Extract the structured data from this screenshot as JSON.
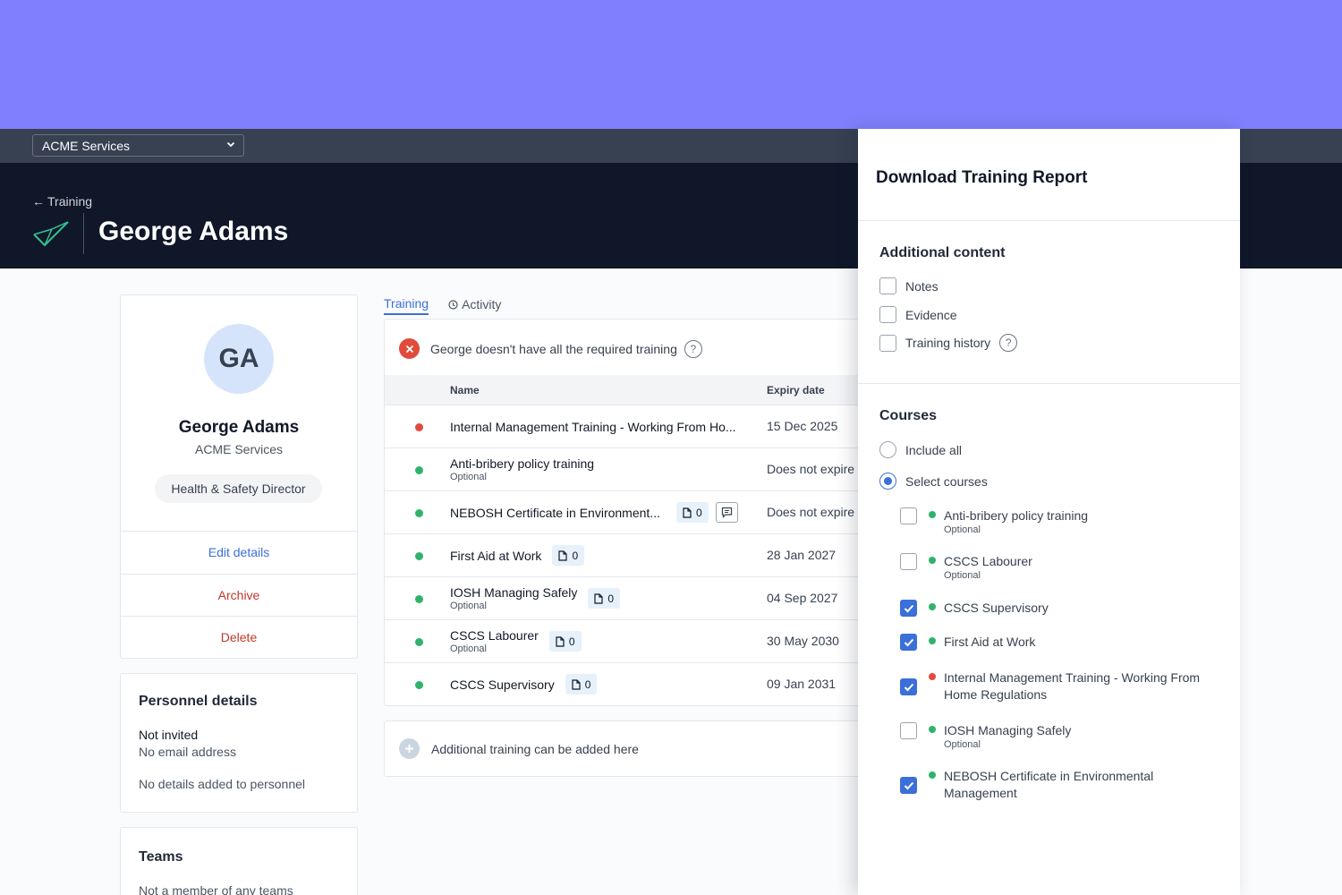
{
  "topbar": {
    "org_select": "ACME Services"
  },
  "header": {
    "back_label": "Training",
    "title": "George Adams"
  },
  "profile": {
    "initials": "GA",
    "name": "George Adams",
    "org": "ACME Services",
    "role": "Health & Safety Director",
    "actions": {
      "edit": "Edit details",
      "archive": "Archive",
      "delete": "Delete"
    }
  },
  "personnel": {
    "title": "Personnel details",
    "status": "Not invited",
    "email": "No email address",
    "details": "No details added to personnel"
  },
  "teams": {
    "title": "Teams",
    "subtitle": "Not a member of any teams"
  },
  "tabs": {
    "training": "Training",
    "activity": "Activity"
  },
  "training": {
    "alert": "George doesn't have all the required training",
    "help": "?",
    "col_name": "Name",
    "col_expiry": "Expiry date",
    "rows": [
      {
        "name": "Internal Management Training - Working From Ho...",
        "optional": "",
        "evidence": "",
        "expiry": "15 Dec 2025",
        "status_color": "#e14b3b"
      },
      {
        "name": "Anti-bribery policy training",
        "optional": "Optional",
        "evidence": "",
        "expiry": "Does not expire",
        "status_color": "#2fb36b"
      },
      {
        "name": "NEBOSH Certificate in Environment...",
        "optional": "",
        "evidence": "0",
        "expiry": "Does not expire",
        "status_color": "#2fb36b"
      },
      {
        "name": "First Aid at Work",
        "optional": "",
        "evidence": "0",
        "expiry": "28 Jan 2027",
        "status_color": "#2fb36b"
      },
      {
        "name": "IOSH Managing Safely",
        "optional": "Optional",
        "evidence": "0",
        "expiry": "04 Sep 2027",
        "status_color": "#2fb36b"
      },
      {
        "name": "CSCS Labourer",
        "optional": "Optional",
        "evidence": "0",
        "expiry": "30 May 2030",
        "status_color": "#2fb36b"
      },
      {
        "name": "CSCS Supervisory",
        "optional": "",
        "evidence": "0",
        "expiry": "09 Jan 2031",
        "status_color": "#2fb36b"
      }
    ],
    "add_label": "Additional training can be added here"
  },
  "panel": {
    "title": "Download Training Report",
    "additional_title": "Additional content",
    "additional": [
      {
        "label": "Notes",
        "checked": false
      },
      {
        "label": "Evidence",
        "checked": false
      },
      {
        "label": "Training history",
        "checked": false
      }
    ],
    "help": "?",
    "courses_title": "Courses",
    "include_all": "Include all",
    "select_courses": "Select courses",
    "courses": [
      {
        "name": "Anti-bribery policy training",
        "optional": "Optional",
        "checked": false,
        "status_color": "#2fb36b"
      },
      {
        "name": "CSCS Labourer",
        "optional": "Optional",
        "checked": false,
        "status_color": "#2fb36b"
      },
      {
        "name": "CSCS Supervisory",
        "optional": "",
        "checked": true,
        "status_color": "#2fb36b"
      },
      {
        "name": "First Aid at Work",
        "optional": "",
        "checked": true,
        "status_color": "#2fb36b"
      },
      {
        "name": "Internal Management Training - Working From Home Regulations",
        "optional": "",
        "checked": true,
        "status_color": "#e14b3b"
      },
      {
        "name": "IOSH Managing Safely",
        "optional": "Optional",
        "checked": false,
        "status_color": "#2fb36b"
      },
      {
        "name": "NEBOSH Certificate in Environmental Management",
        "optional": "",
        "checked": true,
        "status_color": "#2fb36b"
      }
    ]
  }
}
